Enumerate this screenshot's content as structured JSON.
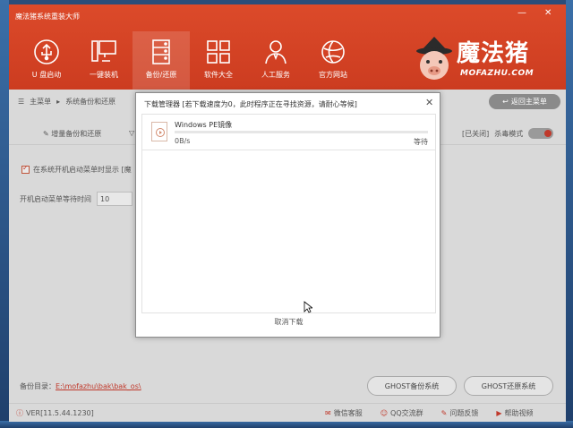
{
  "app": {
    "title": "魔法猪系统重装大师"
  },
  "nav": [
    {
      "label": "U 盘启动",
      "icon": "usb-icon"
    },
    {
      "label": "一键装机",
      "icon": "computer-icon"
    },
    {
      "label": "备份/还原",
      "icon": "database-icon",
      "active": true
    },
    {
      "label": "软件大全",
      "icon": "apps-grid-icon"
    },
    {
      "label": "人工服务",
      "icon": "support-user-icon"
    },
    {
      "label": "官方网站",
      "icon": "globe-icon"
    }
  ],
  "logo": {
    "text": "魔法猪",
    "sub": "MOFAZHU.COM"
  },
  "breadcrumb": {
    "home": "主菜单",
    "current": "系统备份和还原"
  },
  "back_button": "返回主菜单",
  "subtabs": {
    "tab1": "增量备份和还原"
  },
  "antivirus": {
    "state_label": "[已关闭]",
    "label": "杀毒模式"
  },
  "options": {
    "show_menu_label": "在系统开机启动菜单时显示 [魔",
    "wait_label": "开机启动菜单等待时间",
    "wait_value": "10"
  },
  "footer": {
    "backup_dir_label": "备份目录：",
    "backup_dir_path": "E:\\mofazhu\\bak\\bak_os\\",
    "ghost_backup": "GHOST备份系统",
    "ghost_restore": "GHOST还原系统"
  },
  "statusbar": {
    "version": "VER[11.5.44.1230]",
    "links": [
      "微信客服",
      "QQ交流群",
      "问题反馈",
      "帮助视频"
    ]
  },
  "download_dialog": {
    "title": "下载管理器 [若下载速度为0，此时程序正在寻找资源，请耐心等候]",
    "items": [
      {
        "name": "Windows PE镜像",
        "speed": "0B/s",
        "status": "等待",
        "progress": 0.0
      }
    ],
    "cancel_label": "取消下载"
  },
  "colors": {
    "brand": "#cc3c20",
    "accent": "#d9472a"
  }
}
